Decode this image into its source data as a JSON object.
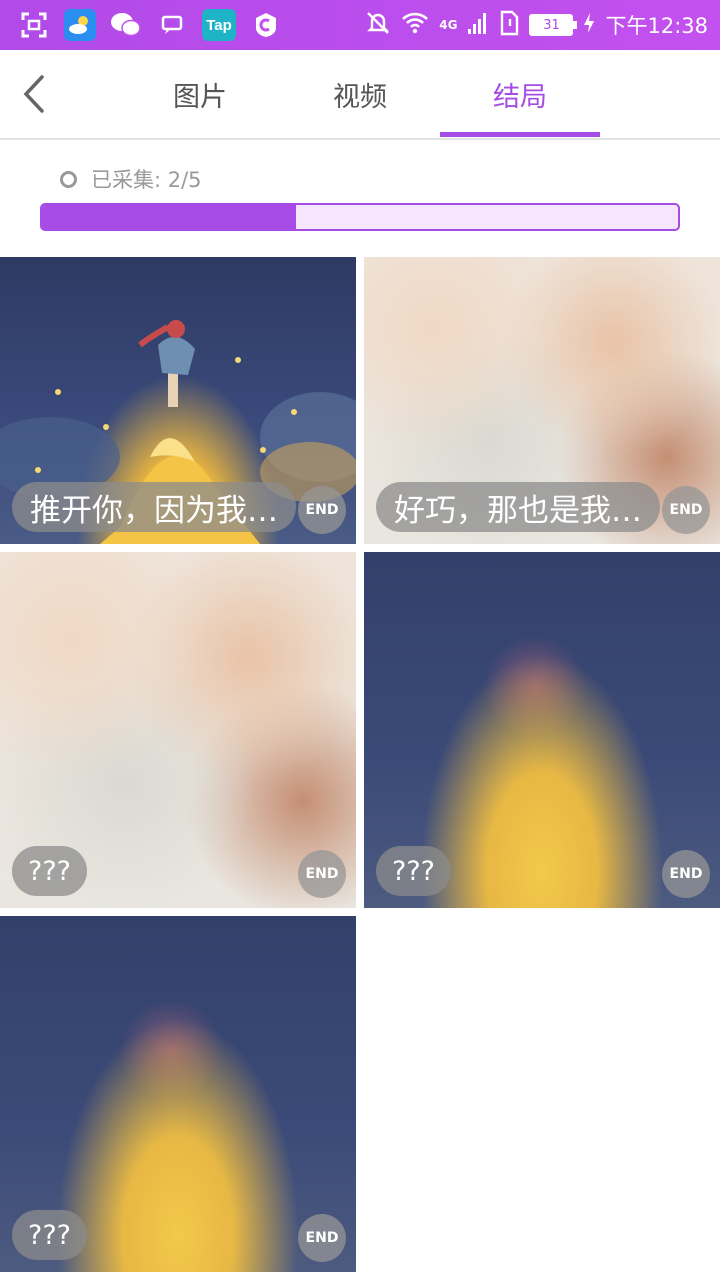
{
  "status_bar": {
    "time": "下午12:38",
    "battery": "31",
    "network": "4G",
    "app_icons": [
      "scan-icon",
      "weather-icon",
      "wechat-icon",
      "message-icon",
      "taptap-icon",
      "game-icon"
    ]
  },
  "header": {
    "tabs": [
      {
        "label": "图片",
        "active": false
      },
      {
        "label": "视频",
        "active": false
      },
      {
        "label": "结局",
        "active": true
      }
    ],
    "accent": "#a64be6"
  },
  "progress": {
    "label": "已采集: 2/5",
    "collected": 2,
    "total": 5
  },
  "endings": [
    {
      "caption": "推开你，因为我…",
      "badge": "END",
      "unlocked": true
    },
    {
      "caption": "好巧，那也是我…",
      "badge": "END",
      "unlocked": true
    },
    {
      "caption": "???",
      "badge": "END",
      "unlocked": false
    },
    {
      "caption": "???",
      "badge": "END",
      "unlocked": false
    },
    {
      "caption": "???",
      "badge": "END",
      "unlocked": false
    }
  ]
}
